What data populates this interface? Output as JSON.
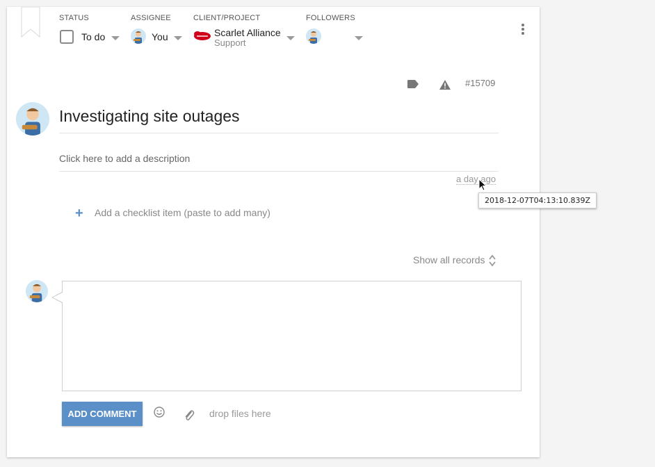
{
  "header": {
    "status_label": "STATUS",
    "status_value": "To do",
    "assignee_label": "ASSIGNEE",
    "assignee_value": "You",
    "client_label": "CLIENT/PROJECT",
    "client_name": "Scarlet Alliance",
    "client_project": "Support",
    "followers_label": "FOLLOWERS"
  },
  "meta": {
    "task_id": "#15709",
    "tag_icon": "tag-icon",
    "priority_icon": "warning-icon"
  },
  "task": {
    "title": "Investigating site outages",
    "description_placeholder": "Click here to add a description",
    "relative_time": "a day ago",
    "timestamp_tooltip": "2018-12-07T04:13:10.839Z"
  },
  "checklist": {
    "add_label": "Add a checklist item (paste to add many)"
  },
  "records": {
    "show_all_label": "Show all records"
  },
  "comment": {
    "add_button": "ADD COMMENT",
    "drop_files": "drop files here"
  },
  "colors": {
    "accent": "#5b8fc8",
    "client_logo": "#d0021b"
  }
}
